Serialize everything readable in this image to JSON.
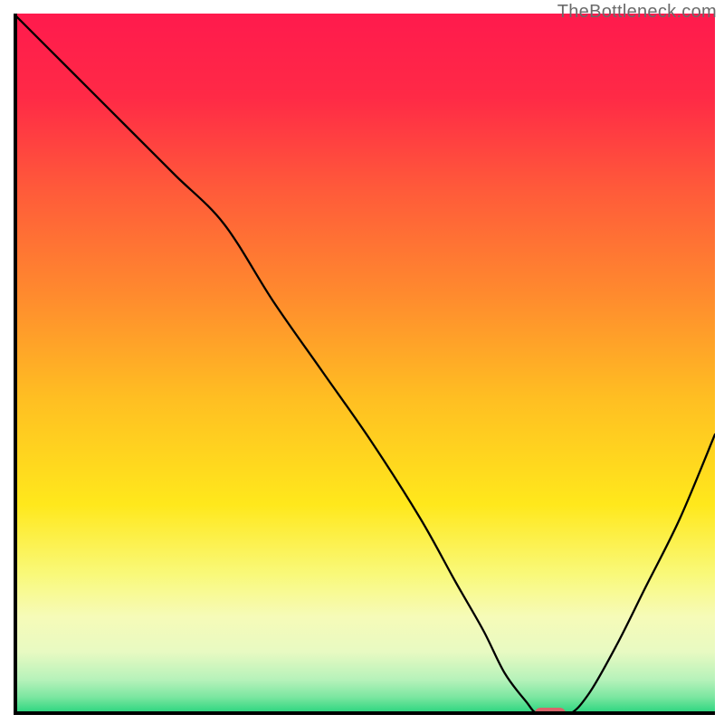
{
  "watermark": "TheBottleneck.com",
  "chart_data": {
    "type": "line",
    "title": "",
    "xlabel": "",
    "ylabel": "",
    "xlim": [
      0,
      100
    ],
    "ylim": [
      0,
      100
    ],
    "background_gradient": {
      "type": "vertical",
      "stops": [
        {
          "pos": 0.0,
          "color": "#ff1a4d"
        },
        {
          "pos": 0.12,
          "color": "#ff2a46"
        },
        {
          "pos": 0.25,
          "color": "#ff5a3a"
        },
        {
          "pos": 0.4,
          "color": "#ff8a2e"
        },
        {
          "pos": 0.55,
          "color": "#ffbf22"
        },
        {
          "pos": 0.7,
          "color": "#ffe81c"
        },
        {
          "pos": 0.8,
          "color": "#f9f97a"
        },
        {
          "pos": 0.86,
          "color": "#f6fbb8"
        },
        {
          "pos": 0.91,
          "color": "#e8fac2"
        },
        {
          "pos": 0.95,
          "color": "#b6f2ba"
        },
        {
          "pos": 0.975,
          "color": "#7ae6a0"
        },
        {
          "pos": 1.0,
          "color": "#1fd27a"
        }
      ]
    },
    "series": [
      {
        "name": "bottleneck-curve",
        "color": "#000000",
        "width": 2.3,
        "x": [
          0,
          8,
          16,
          23,
          30,
          37,
          44,
          51,
          58,
          63,
          67,
          70,
          73,
          75,
          79,
          82,
          86,
          90,
          95,
          100
        ],
        "y": [
          100,
          92,
          84,
          77,
          70,
          59,
          49,
          39,
          28,
          19,
          12,
          6,
          2,
          0,
          0,
          3,
          10,
          18,
          28,
          40
        ]
      }
    ],
    "marker": {
      "name": "optimal-zone",
      "shape": "capsule",
      "x_center": 76.5,
      "y": 0,
      "width_x": 4.5,
      "color": "#d9646a"
    },
    "frame": {
      "left": true,
      "bottom": true,
      "right": false,
      "top": false,
      "color": "#000000",
      "width": 4
    }
  }
}
